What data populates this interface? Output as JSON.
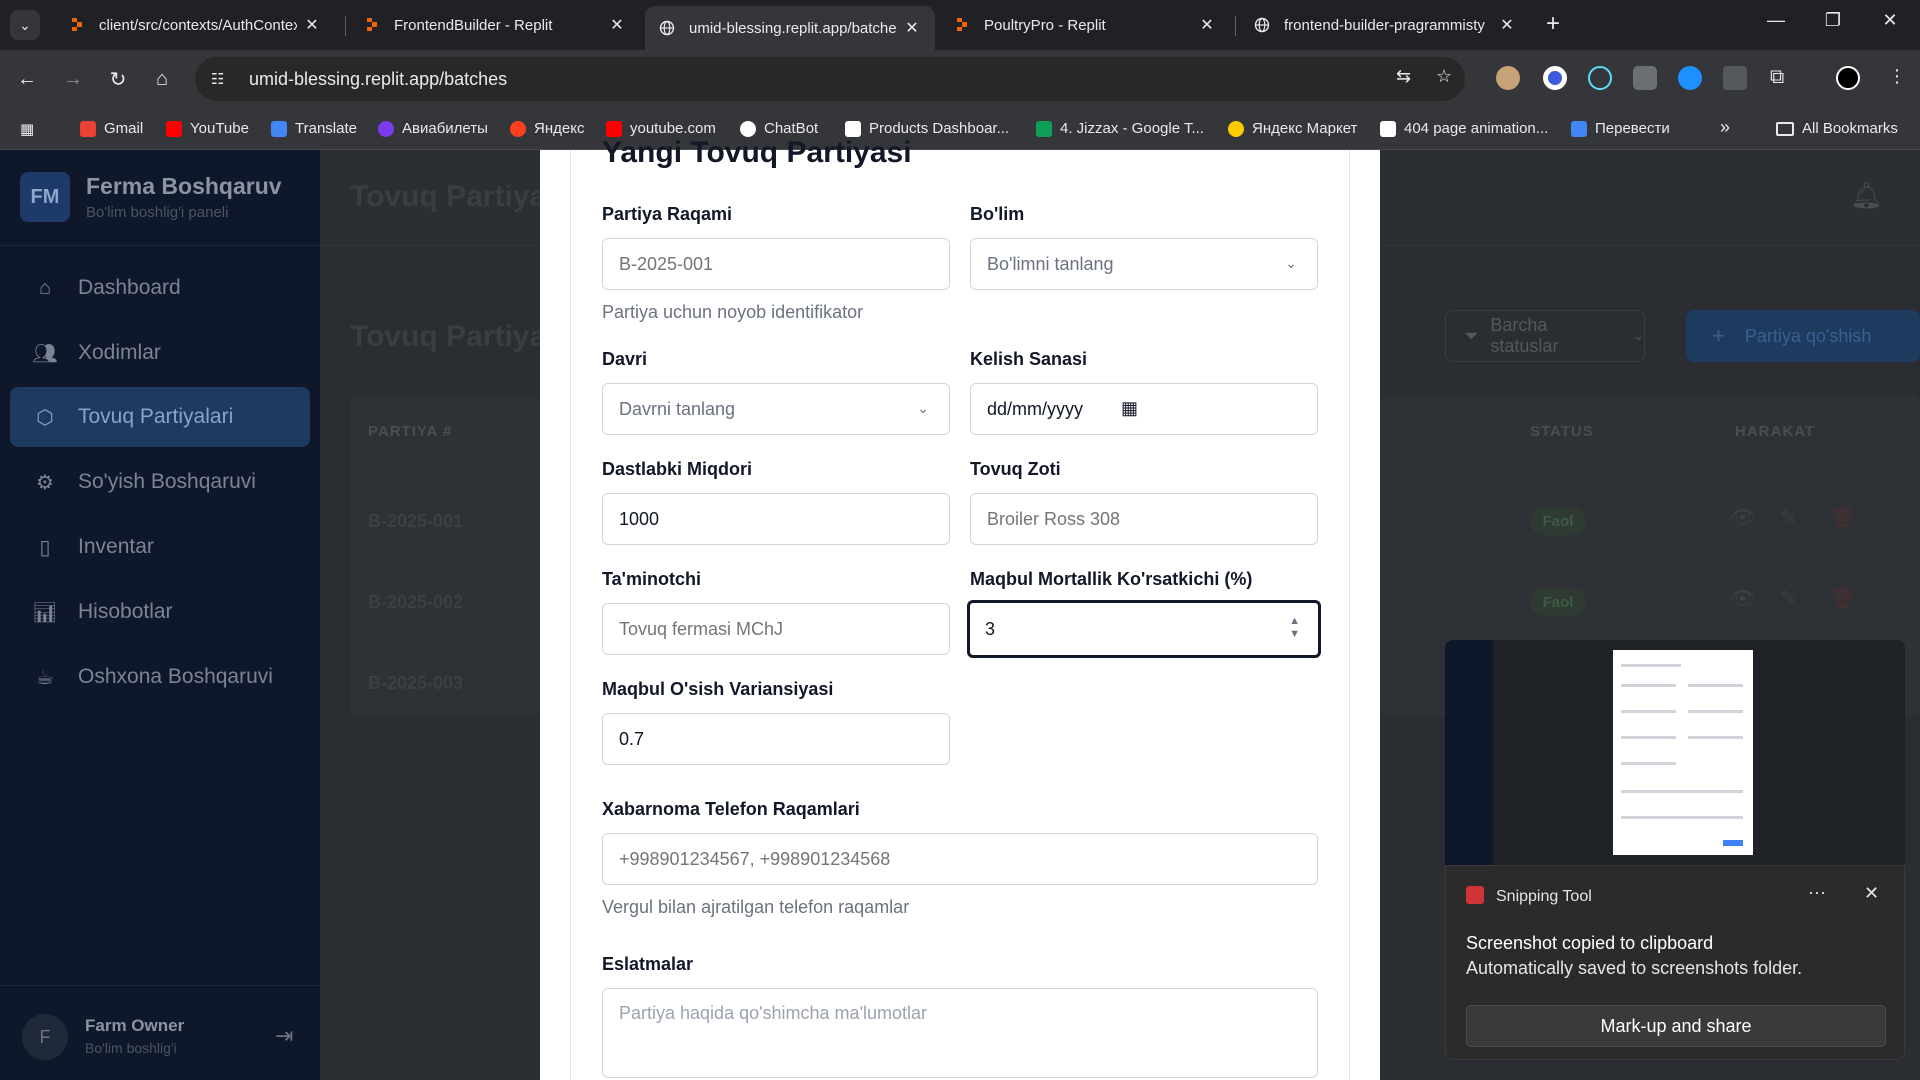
{
  "browser": {
    "tabs": [
      {
        "title": "client/src/contexts/AuthContext",
        "icon": "replit-icon"
      },
      {
        "title": "FrontendBuilder - Replit",
        "icon": "replit-icon"
      },
      {
        "title": "umid-blessing.replit.app/batche",
        "icon": "globe-icon"
      },
      {
        "title": "PoultryPro - Replit",
        "icon": "replit-icon"
      },
      {
        "title": "frontend-builder-pragrammisty",
        "icon": "globe-icon"
      }
    ],
    "url": "umid-blessing.replit.app/batches",
    "bookmarks": [
      "Gmail",
      "YouTube",
      "Translate",
      "Авиабилеты",
      "Яндекс",
      "youtube.com",
      "ChatBot",
      "Products Dashboar...",
      "4. Jizzax - Google T...",
      "Яндекс Маркет",
      "404 page animation...",
      "Перевести"
    ],
    "all_bookmarks": "All Bookmarks"
  },
  "sidebar": {
    "logo": "FM",
    "title": "Ferma Boshqaruv",
    "subtitle": "Bo'lim boshlig'i paneli",
    "items": [
      {
        "label": "Dashboard",
        "icon": "home-icon"
      },
      {
        "label": "Xodimlar",
        "icon": "users-icon"
      },
      {
        "label": "Tovuq Partiyalari",
        "icon": "package-icon",
        "active": true
      },
      {
        "label": "So'yish Boshqaruvi",
        "icon": "gear-icon"
      },
      {
        "label": "Inventar",
        "icon": "clipboard-icon"
      },
      {
        "label": "Hisobotlar",
        "icon": "bar-chart-icon"
      },
      {
        "label": "Oshxona Boshqaruvi",
        "icon": "coffee-icon"
      }
    ],
    "user": {
      "initial": "F",
      "name": "Farm Owner",
      "role": "Bo'lim boshlig'i"
    }
  },
  "main": {
    "page_title": "Tovuq Partiyalari",
    "section_title": "Tovuq Partiyalari",
    "filter_label": "Barcha statuslar",
    "add_button": "Partiya qo'shish",
    "table": {
      "headers": [
        "PARTIYA #",
        "STATUS",
        "HARAKAT"
      ],
      "rows": [
        {
          "id": "B-2025-001",
          "status": "Faol"
        },
        {
          "id": "B-2025-002",
          "status": "Faol"
        },
        {
          "id": "B-2025-003",
          "status": ""
        }
      ]
    }
  },
  "modal": {
    "title": "Yangi Tovuq Partiyasi",
    "fields": {
      "batch_number": {
        "label": "Partiya Raqami",
        "placeholder": "B-2025-001",
        "help": "Partiya uchun noyob identifikator"
      },
      "section": {
        "label": "Bo'lim",
        "value": "Bo'limni tanlang"
      },
      "period": {
        "label": "Davri",
        "value": "Davrni tanlang"
      },
      "arrival_date": {
        "label": "Kelish Sanasi",
        "value": "dd/mm/yyyy"
      },
      "initial_quantity": {
        "label": "Dastlabki Miqdori",
        "value": "1000"
      },
      "breed": {
        "label": "Tovuq Zoti",
        "placeholder": "Broiler Ross 308"
      },
      "supplier": {
        "label": "Ta'minotchi",
        "placeholder": "Tovuq fermasi MChJ"
      },
      "mortality": {
        "label": "Maqbul Mortallik Ko'rsatkichi (%)",
        "value": "3"
      },
      "growth_variance": {
        "label": "Maqbul O'sish Variansiyasi",
        "value": "0.7"
      },
      "phones": {
        "label": "Xabarnoma Telefon Raqamlari",
        "placeholder": "+998901234567, +998901234568",
        "help": "Vergul bilan ajratilgan telefon raqamlar"
      },
      "notes": {
        "label": "Eslatmalar",
        "placeholder": "Partiya haqida qo'shimcha ma'lumotlar"
      }
    }
  },
  "snipping_tool": {
    "app_name": "Snipping Tool",
    "heading": "Screenshot copied to clipboard",
    "subtext": "Automatically saved to screenshots folder.",
    "button": "Mark-up and share"
  }
}
